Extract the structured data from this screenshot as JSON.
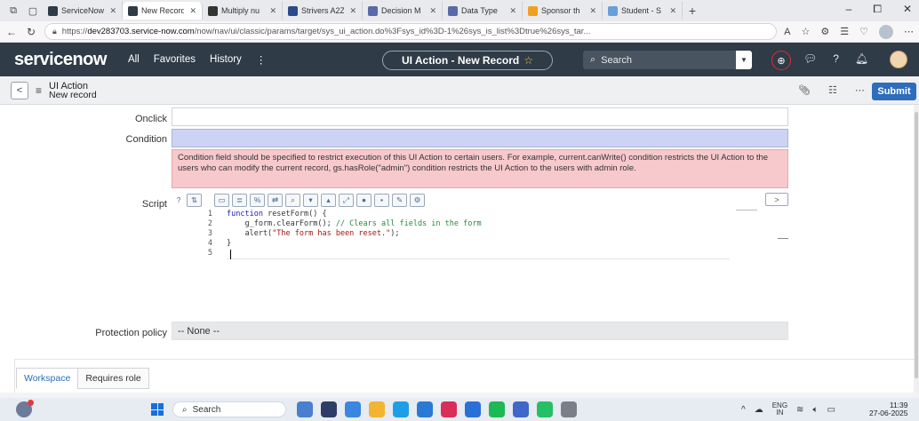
{
  "browser": {
    "tabs": [
      {
        "label": "ServiceNow",
        "color": "#2f3b47"
      },
      {
        "label": "New Record",
        "color": "#2f3b47",
        "active": true
      },
      {
        "label": "Multiply nu",
        "color": "#333333"
      },
      {
        "label": "Strivers A2Z",
        "color": "#2a4a8a"
      },
      {
        "label": "Decision M",
        "color": "#5a6aa8"
      },
      {
        "label": "Data Type",
        "color": "#5a6aa8"
      },
      {
        "label": "Sponsor th",
        "color": "#f0a020"
      },
      {
        "label": "Student - S",
        "color": "#6aa0d8"
      }
    ],
    "url_prefix": "https://",
    "url_host": "dev283703.service-now.com",
    "url_path": "/now/nav/ui/classic/params/target/sys_ui_action.do%3Fsys_id%3D-1%26sys_is_list%3Dtrue%26sys_tar..."
  },
  "header": {
    "logo": "servicenow",
    "menu": [
      "All",
      "Favorites",
      "History",
      "⋮"
    ],
    "record_title": "UI Action - New Record",
    "search_placeholder": "Search"
  },
  "form_header": {
    "title": "UI Action",
    "subtitle": "New record",
    "submit_label": "Submit"
  },
  "fields": {
    "onclick_label": "Onclick",
    "condition_label": "Condition",
    "condition_hint": "Condition field should be specified to restrict execution of this UI Action to certain users. For example, current.canWrite() condition restricts the UI Action to the users who can modify the current record, gs.hasRole(\"admin\") condition restricts the UI Action to the users with admin role.",
    "script_label": "Script",
    "protection_label": "Protection policy",
    "protection_value": "-- None --"
  },
  "script": {
    "line_numbers": [
      "1",
      "2",
      "3",
      "4",
      "5"
    ],
    "lines": [
      {
        "kw": "function",
        "rest": " resetForm() {"
      },
      {
        "code": "    g_form.clearForm(); ",
        "comment": "// Clears all fields in the form"
      },
      {
        "code": "    alert(",
        "string": "\"The form has been reset.\"",
        "tail": ");"
      },
      {
        "code": "}"
      },
      {
        "code": ""
      }
    ]
  },
  "related_tabs": [
    "Workspace",
    "Requires role"
  ],
  "taskbar": {
    "search_label": "Search",
    "lang_top": "ENG",
    "lang_bottom": "IN",
    "time": "11:39",
    "date": "27-06-2025"
  }
}
